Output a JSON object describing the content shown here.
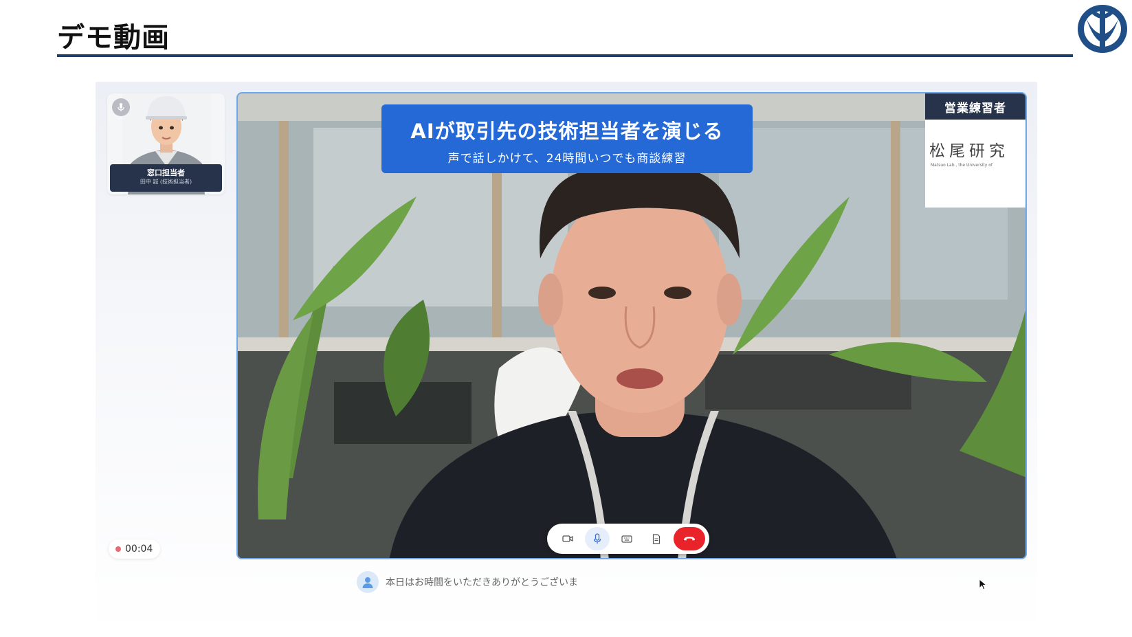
{
  "slide": {
    "title": "デモ動画"
  },
  "agent_tile": {
    "name": "窓口担当者",
    "role": "田中 誠 (技術担当者)"
  },
  "timer": {
    "elapsed": "00:04"
  },
  "video": {
    "caption_title": "AIが取引先の技術担当者を演じる",
    "caption_subtitle": "声で話しかけて、24時間いつでも商談練習",
    "role_tag": "営業練習者",
    "lab_name": "松尾研究",
    "lab_sub": "Matsuo Lab., the University of"
  },
  "controls": {
    "items": [
      "camera-icon",
      "microphone-icon",
      "keyboard-icon",
      "document-icon",
      "end-call-icon"
    ]
  },
  "transcript": {
    "text": "本日はお時間をいただきありがとうございま"
  },
  "colors": {
    "accent": "#2469d6",
    "title_rule": "#1f3f6b",
    "end_call": "#e8232a",
    "plate": "#27334a"
  }
}
